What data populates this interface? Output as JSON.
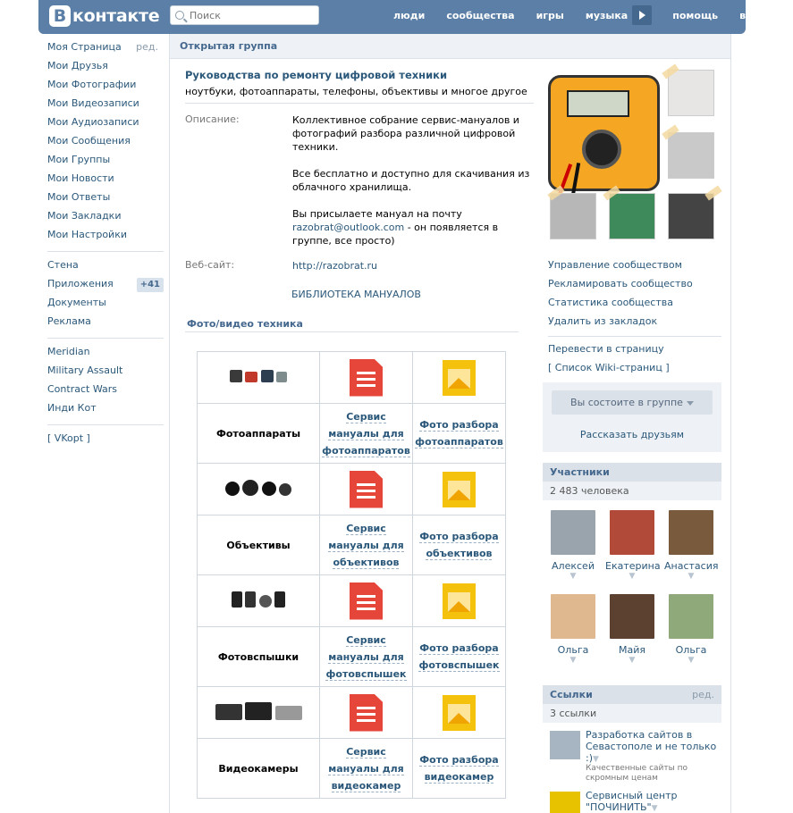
{
  "header": {
    "logo_letter": "В",
    "logo_text": "контакте",
    "search_placeholder": "Поиск",
    "nav": [
      "люди",
      "сообщества",
      "игры",
      "музыка",
      "помощь",
      "выйти"
    ]
  },
  "sidebar": {
    "edit": "ред.",
    "items1": [
      "Моя Страница",
      "Мои Друзья",
      "Мои Фотографии",
      "Мои Видеозаписи",
      "Мои Аудиозаписи",
      "Мои Сообщения",
      "Мои Группы",
      "Мои Новости",
      "Мои Ответы",
      "Мои Закладки",
      "Мои Настройки"
    ],
    "items2": [
      "Стена",
      "Приложения",
      "Документы",
      "Реклама"
    ],
    "apps_badge": "+41",
    "items3": [
      "Meridian",
      "Military Assault",
      "Contract Wars",
      "Инди Кот"
    ],
    "vkopt": "[ VKopt ]"
  },
  "main": {
    "header": "Открытая группа",
    "title": "Руководства по ремонту цифровой техники",
    "status": "ноутбуки, фотоаппараты, телефоны, объективы и многое другое",
    "desc_label": "Описание:",
    "desc_p1": "Коллективное собрание сервис-мануалов и фотографий разбора различной цифровой техники.",
    "desc_p2": "Все бесплатно и доступно для скачивания из облачного хранилища.",
    "desc_p3a": "Вы присылаете мануал на почту",
    "desc_email": "razobrat@outlook.com",
    "desc_p3b": " - он появляется в группе, все просто)",
    "site_label": "Веб-сайт:",
    "site_url": "http://razobrat.ru",
    "library": "БИБЛИОТЕКА МАНУАЛОВ",
    "section": "Фото/видео техника",
    "categories": [
      {
        "name": "Фотоаппараты",
        "manual": [
          "Сервис",
          "мануалы для",
          "фотоаппаратов"
        ],
        "photo": [
          "Фото разбора",
          "фотоаппаратов"
        ]
      },
      {
        "name": "Объективы",
        "manual": [
          "Сервис",
          "мануалы для",
          "объективов"
        ],
        "photo": [
          "Фото разбора",
          "объективов"
        ]
      },
      {
        "name": "Фотовспышки",
        "manual": [
          "Сервис",
          "мануалы для",
          "фотовспышек"
        ],
        "photo": [
          "Фото разбора",
          "фотовспышек"
        ]
      },
      {
        "name": "Видеокамеры",
        "manual": [
          "Сервис",
          "мануалы для",
          "видеокамер"
        ],
        "photo": [
          "Фото разбора",
          "видеокамер"
        ]
      }
    ]
  },
  "right": {
    "links1": [
      "Управление сообществом",
      "Рекламировать сообщество",
      "Статистика сообщества",
      "Удалить из закладок"
    ],
    "links2": [
      "Перевести в страницу",
      "[ Список Wiki-страниц ]"
    ],
    "member_button": "Вы состоите в группе",
    "tell_friends": "Рассказать друзьям",
    "members_title": "Участники",
    "members_count": "2 483 человека",
    "members": [
      "Алексей",
      "Екатерина",
      "Анастасия",
      "Ольга",
      "Майя",
      "Ольга"
    ],
    "links_title": "Ссылки",
    "links_edit": "ред.",
    "links_count": "3 ссылки",
    "ext_links": [
      {
        "title": "Разработка сайтов в Севастополе и не только :)",
        "desc": "Качественные сайты по скромным ценам"
      },
      {
        "title": "Сервисный центр \"ПОЧИНИТЬ\"",
        "desc": ""
      }
    ]
  }
}
